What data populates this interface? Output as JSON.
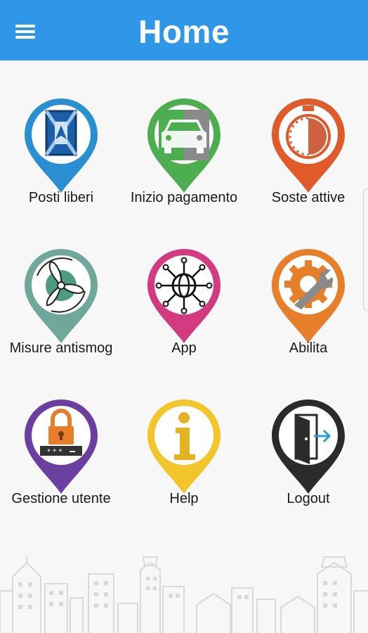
{
  "header": {
    "title": "Home",
    "menu_icon": "hamburger-menu-icon"
  },
  "tiles": [
    {
      "label": "Posti liberi",
      "icon": "map-pin-icon",
      "color": "#2a8fd1"
    },
    {
      "label": "Inizio pagamento",
      "icon": "car-icon",
      "color": "#4cae4f"
    },
    {
      "label": "Soste attive",
      "icon": "timer-icon",
      "color": "#e05a2a"
    },
    {
      "label": "Misure antismog",
      "icon": "fan-icon",
      "color": "#6fa89a"
    },
    {
      "label": "App",
      "icon": "network-globe-icon",
      "color": "#d43a80"
    },
    {
      "label": "Abilita",
      "icon": "gear-wrench-icon",
      "color": "#e67e2a"
    },
    {
      "label": "Gestione utente",
      "icon": "lock-password-icon",
      "color": "#6a3fa0"
    },
    {
      "label": "Help",
      "icon": "info-icon",
      "color": "#f2c52a"
    },
    {
      "label": "Logout",
      "icon": "door-exit-icon",
      "color": "#2b2b2b"
    }
  ]
}
